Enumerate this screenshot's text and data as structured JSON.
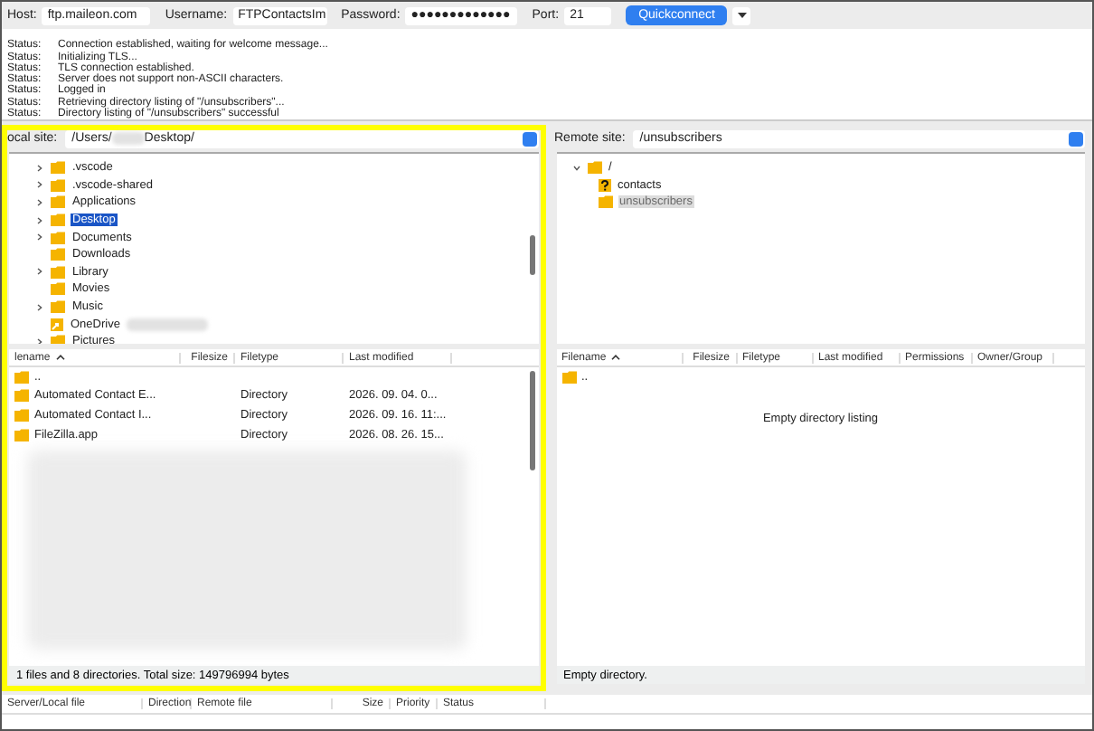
{
  "connection": {
    "host_label": "Host:",
    "host": "ftp.maileon.com",
    "username_label": "Username:",
    "username": "FTPContactsIm",
    "password_label": "Password:",
    "password": "●●●●●●●●●●●●●",
    "port_label": "Port:",
    "port": "21",
    "quickconnect": "Quickconnect"
  },
  "log": [
    {
      "label": "Status:",
      "message": "Connection established, waiting for welcome message..."
    },
    {
      "label": "Status:",
      "message": "Initializing TLS..."
    },
    {
      "label": "Status:",
      "message": "TLS connection established."
    },
    {
      "label": "Status:",
      "message": "Server does not support non-ASCII characters."
    },
    {
      "label": "Status:",
      "message": "Logged in"
    },
    {
      "label": "Status:",
      "message": "Retrieving directory listing of \"/unsubscribers\"..."
    },
    {
      "label": "Status:",
      "message": "Directory listing of \"/unsubscribers\" successful"
    }
  ],
  "local": {
    "site_label": "ocal site:",
    "path_parts": [
      "/Users/",
      "Desktop/"
    ],
    "tree": [
      {
        "name": ".vscode",
        "kind": "folder",
        "expandable": true,
        "selected": false
      },
      {
        "name": ".vscode-shared",
        "kind": "folder",
        "expandable": true,
        "selected": false
      },
      {
        "name": "Applications",
        "kind": "folder",
        "expandable": true,
        "selected": false
      },
      {
        "name": "Desktop",
        "kind": "folder",
        "expandable": true,
        "selected": true
      },
      {
        "name": "Documents",
        "kind": "folder",
        "expandable": true,
        "selected": false
      },
      {
        "name": "Downloads",
        "kind": "folder",
        "expandable": false,
        "selected": false
      },
      {
        "name": "Library",
        "kind": "folder",
        "expandable": true,
        "selected": false
      },
      {
        "name": "Movies",
        "kind": "folder",
        "expandable": false,
        "selected": false
      },
      {
        "name": "Music",
        "kind": "folder",
        "expandable": true,
        "selected": false
      },
      {
        "name": "OneDrive",
        "kind": "alias",
        "expandable": false,
        "selected": false
      },
      {
        "name": "Pictures",
        "kind": "folder",
        "expandable": true,
        "selected": false
      }
    ],
    "columns": [
      "lename",
      "Filesize",
      "Filetype",
      "Last modified"
    ],
    "rows": [
      {
        "name": "..",
        "filetype": "",
        "modified": ""
      },
      {
        "name": "Automated Contact E...",
        "filetype": "Directory",
        "modified": "2026. 09. 04. 0..."
      },
      {
        "name": "Automated Contact I...",
        "filetype": "Directory",
        "modified": "2026. 09. 16. 11:..."
      },
      {
        "name": "FileZilla.app",
        "filetype": "Directory",
        "modified": "2026. 08. 26. 15..."
      }
    ],
    "status": "1 files and 8 directories. Total size: 149796994 bytes"
  },
  "remote": {
    "site_label": "Remote site:",
    "path": "/unsubscribers",
    "tree": [
      {
        "name": "/",
        "kind": "folder",
        "expanded": true,
        "selected": false,
        "children": [
          {
            "name": "contacts",
            "kind": "unknown",
            "selected": false
          },
          {
            "name": "unsubscribers",
            "kind": "folder",
            "selected": true
          }
        ]
      }
    ],
    "columns": [
      "Filename",
      "Filesize",
      "Filetype",
      "Last modified",
      "Permissions",
      "Owner/Group"
    ],
    "rows": [
      {
        "name": ".."
      }
    ],
    "empty_message": "Empty directory listing",
    "status": "Empty directory."
  },
  "queue": {
    "columns": [
      "Server/Local file",
      "Direction",
      "Remote file",
      "Size",
      "Priority",
      "Status"
    ]
  }
}
